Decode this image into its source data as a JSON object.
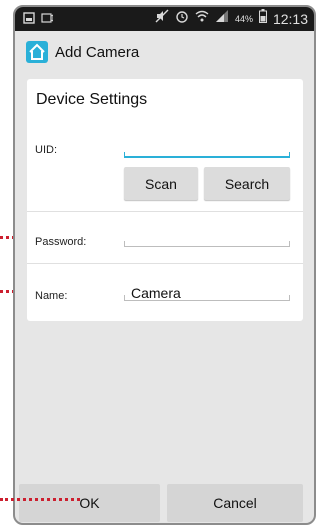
{
  "status_bar": {
    "time": "12:13",
    "battery_percent": "44%",
    "icons": [
      "gallery-icon",
      "screen-icon",
      "mute-icon",
      "alarm-icon",
      "wifi-icon",
      "signal-icon",
      "battery-icon"
    ]
  },
  "titlebar": {
    "title": "Add Camera",
    "app_icon": "home-icon",
    "accent_color": "#2ab0d8"
  },
  "card": {
    "title": "Device Settings",
    "uid": {
      "label": "UID:",
      "value": ""
    },
    "scan_label": "Scan",
    "search_label": "Search",
    "password": {
      "label": "Password:",
      "value": ""
    },
    "name": {
      "label": "Name:",
      "value": "Camera"
    }
  },
  "footer": {
    "ok_label": "OK",
    "cancel_label": "Cancel"
  },
  "annotation_color": "#cc1f2f"
}
